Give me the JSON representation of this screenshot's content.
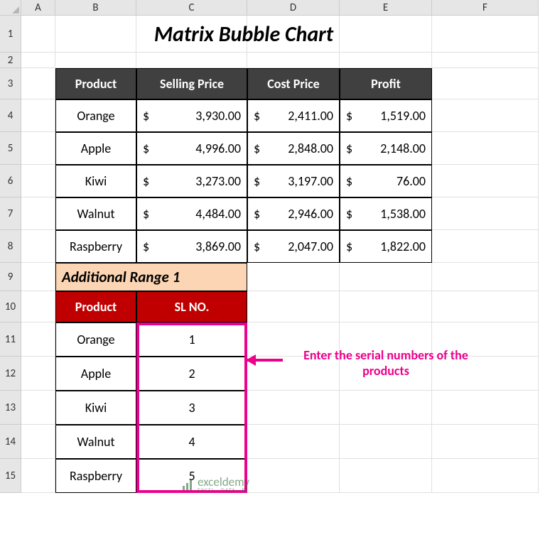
{
  "columns": [
    "A",
    "B",
    "C",
    "D",
    "E",
    "F"
  ],
  "rows": [
    "1",
    "2",
    "3",
    "4",
    "5",
    "6",
    "7",
    "8",
    "9",
    "10",
    "11",
    "12",
    "13",
    "14",
    "15"
  ],
  "title": "Matrix Bubble Chart",
  "table1": {
    "headers": {
      "product": "Product",
      "selling": "Selling Price",
      "cost": "Cost Price",
      "profit": "Profit"
    },
    "rows": [
      {
        "product": "Orange",
        "selling": "3,930.00",
        "cost": "2,411.00",
        "profit": "1,519.00"
      },
      {
        "product": "Apple",
        "selling": "4,996.00",
        "cost": "2,848.00",
        "profit": "2,148.00"
      },
      {
        "product": "Kiwi",
        "selling": "3,273.00",
        "cost": "3,197.00",
        "profit": "76.00"
      },
      {
        "product": "Walnut",
        "selling": "4,484.00",
        "cost": "2,946.00",
        "profit": "1,538.00"
      },
      {
        "product": "Raspberry",
        "selling": "3,869.00",
        "cost": "2,047.00",
        "profit": "1,822.00"
      }
    ]
  },
  "range_title": "Additional Range 1",
  "table2": {
    "headers": {
      "product": "Product",
      "slno": "SL NO."
    },
    "rows": [
      {
        "product": "Orange",
        "slno": "1"
      },
      {
        "product": "Apple",
        "slno": "2"
      },
      {
        "product": "Kiwi",
        "slno": "3"
      },
      {
        "product": "Walnut",
        "slno": "4"
      },
      {
        "product": "Raspberry",
        "slno": "5"
      }
    ]
  },
  "annotation": "Enter the serial numbers of the products",
  "currency": "$",
  "watermark": {
    "text": "exceldemy",
    "sub": "EXCEL · DATA · BI"
  },
  "chart_data": {
    "type": "table",
    "title": "Matrix Bubble Chart",
    "columns": [
      "Product",
      "Selling Price",
      "Cost Price",
      "Profit"
    ],
    "rows": [
      [
        "Orange",
        3930.0,
        2411.0,
        1519.0
      ],
      [
        "Apple",
        4996.0,
        2848.0,
        2148.0
      ],
      [
        "Kiwi",
        3273.0,
        3197.0,
        76.0
      ],
      [
        "Walnut",
        4484.0,
        2946.0,
        1538.0
      ],
      [
        "Raspberry",
        3869.0,
        2047.0,
        1822.0
      ]
    ],
    "additional_range_1": {
      "columns": [
        "Product",
        "SL NO."
      ],
      "rows": [
        [
          "Orange",
          1
        ],
        [
          "Apple",
          2
        ],
        [
          "Kiwi",
          3
        ],
        [
          "Walnut",
          4
        ],
        [
          "Raspberry",
          5
        ]
      ]
    }
  }
}
